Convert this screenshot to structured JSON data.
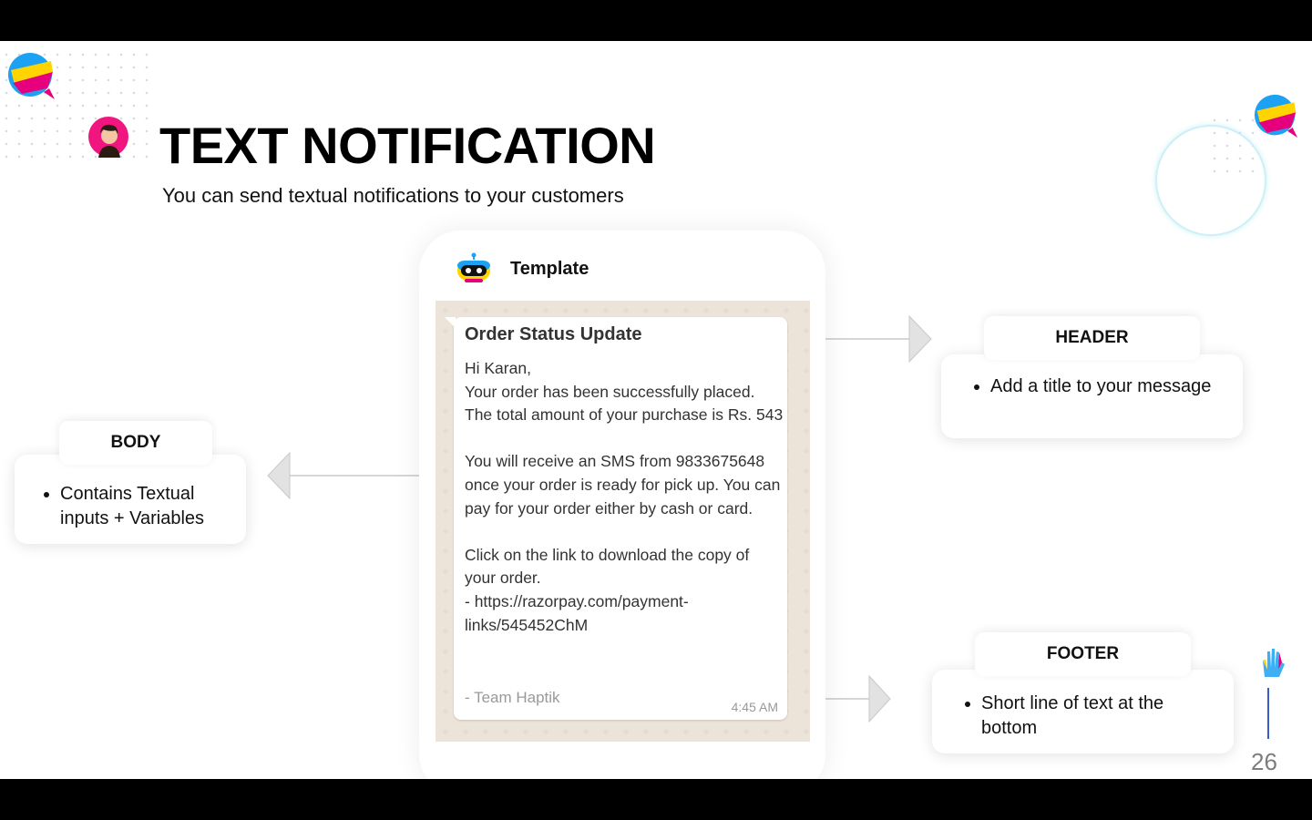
{
  "slide": {
    "title": "TEXT NOTIFICATION",
    "subtitle": "You can send textual notifications to your customers",
    "page_number": "26"
  },
  "phone": {
    "header_label": "Template",
    "message": {
      "title": "Order Status Update",
      "body_lines": [
        "Hi Karan,",
        "Your order has been successfully placed. The total amount of your purchase is Rs. 543",
        "",
        "You will receive an SMS from 9833675648 once your order is ready for pick up. You can pay for your order either by cash or card.",
        "",
        "Click on the link to download the copy of your order.",
        "- https://razorpay.com/payment-links/545452ChM"
      ],
      "footer": "- Team Haptik",
      "time": "4:45 AM"
    }
  },
  "callouts": {
    "header": {
      "label": "HEADER",
      "text": "Add a title to your message"
    },
    "body": {
      "label": "BODY",
      "text": "Contains Textual inputs + Variables"
    },
    "footer": {
      "label": "FOOTER",
      "text": "Short line of text at the bottom"
    }
  },
  "colors": {
    "background": "#ffffff",
    "frame": "#000000",
    "chat_background": "#ece4d9",
    "bubble": "#ffffff",
    "accent_blue": "#3b5ccc",
    "connector": "#c8c8c8"
  },
  "icons": [
    "haptik-logo-icon",
    "avatar-icon",
    "bot-icon",
    "hand-icon"
  ]
}
